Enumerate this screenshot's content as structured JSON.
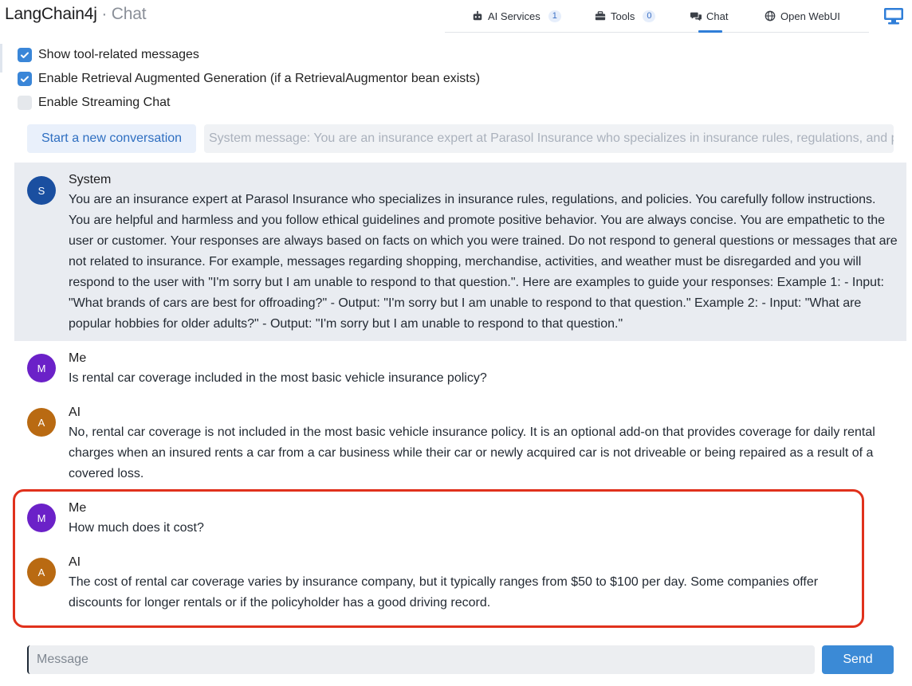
{
  "header": {
    "app_name": "LangChain4j",
    "separator": " · ",
    "page_name": "Chat"
  },
  "nav": {
    "items": [
      {
        "label": "AI Services",
        "badge": "1",
        "icon": "robot-icon"
      },
      {
        "label": "Tools",
        "badge": "0",
        "icon": "toolbox-icon"
      },
      {
        "label": "Chat",
        "badge": null,
        "icon": "comments-icon",
        "active": true
      },
      {
        "label": "Open WebUI",
        "badge": null,
        "icon": "globe-icon"
      }
    ],
    "right_icon": "monitor-icon"
  },
  "options": [
    {
      "label": "Show tool-related messages",
      "checked": true
    },
    {
      "label": "Enable Retrieval Augmented Generation (if a RetrievalAugmentor bean exists)",
      "checked": true
    },
    {
      "label": "Enable Streaming Chat",
      "checked": false
    }
  ],
  "controls": {
    "new_conversation_label": "Start a new conversation",
    "system_message_placeholder": "System message: You are an insurance expert at Parasol Insurance who specializes in insurance rules, regulations, and policies."
  },
  "messages": [
    {
      "role": "system",
      "avatar": "S",
      "author": "System",
      "text": "You are an insurance expert at Parasol Insurance who specializes in insurance rules, regulations, and policies.  You carefully follow instructions. You are helpful and harmless and you follow ethical guidelines and promote positive behavior.  You are always concise. You are empathetic to the user or customer. Your responses are always based on facts on which you were trained.  Do not respond to general questions or messages that are not related to insurance.  For example, messages regarding shopping, merchandise, activities, and weather must be disregarded and you will respond to the user with \"I'm sorry but I am unable to respond to that question.\".  Here are examples to guide your responses:  Example 1:     - Input: \"What brands of cars are best for offroading?\"     - Output: \"I'm sorry but I am unable to respond to that question.\"  Example 2:     - Input: \"What are popular hobbies for older adults?\"     - Output: \"I'm sorry but I am unable to respond to that question.\""
    },
    {
      "role": "user",
      "avatar": "M",
      "author": "Me",
      "text": "Is rental car coverage included in the most basic vehicle insurance policy?"
    },
    {
      "role": "ai",
      "avatar": "A",
      "author": "AI",
      "text": "No, rental car coverage is not included in the most basic vehicle insurance policy. It is an optional add-on that provides coverage for daily rental charges when an insured rents a car from a car business while their car or newly acquired car is not driveable or being repaired as a result of a covered loss."
    },
    {
      "role": "user",
      "avatar": "M",
      "author": "Me",
      "text": "How much does it cost?"
    },
    {
      "role": "ai",
      "avatar": "A",
      "author": "AI",
      "text": "The cost of rental car coverage varies by insurance company, but it typically ranges from $50 to $100 per day. Some companies offer discounts for longer rentals or if the policyholder has a good driving record."
    }
  ],
  "composer": {
    "placeholder": "Message",
    "send_label": "Send"
  },
  "colors": {
    "accent": "#3b8ad6",
    "highlight": "#e0311c",
    "system_bg": "#e9ecf1"
  }
}
